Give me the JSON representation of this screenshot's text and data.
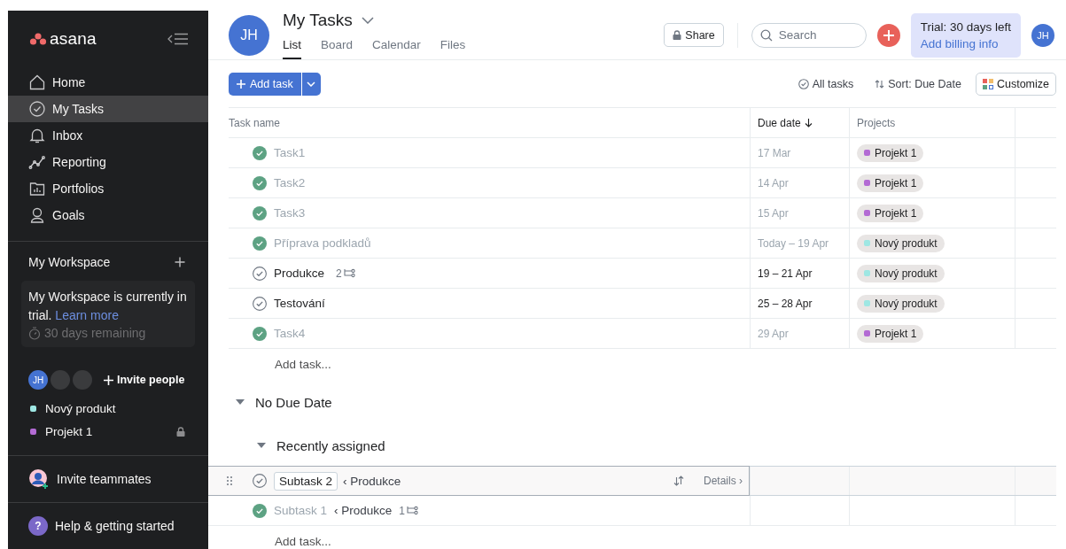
{
  "sidebar": {
    "brand": "asana",
    "nav": [
      {
        "label": "Home",
        "selected": false
      },
      {
        "label": "My Tasks",
        "selected": true
      },
      {
        "label": "Inbox",
        "selected": false
      },
      {
        "label": "Reporting",
        "selected": false
      },
      {
        "label": "Portfolios",
        "selected": false
      },
      {
        "label": "Goals",
        "selected": false
      }
    ],
    "workspace": {
      "title": "My Workspace",
      "trial_text": "My Workspace is currently in trial.",
      "learn_more": "Learn more",
      "remaining": "30 days remaining"
    },
    "members": [
      "JH"
    ],
    "invite_people": "Invite people",
    "projects": [
      {
        "name": "Nový produkt",
        "color": "#9ee7e3",
        "locked": false
      },
      {
        "name": "Projekt 1",
        "color": "#b36bd4",
        "locked": true
      }
    ],
    "invite_teammates": "Invite teammates",
    "help": {
      "icon": "?",
      "label": "Help & getting started"
    }
  },
  "header": {
    "avatar": "JH",
    "title": "My Tasks",
    "tabs": [
      {
        "label": "List",
        "selected": true
      },
      {
        "label": "Board",
        "selected": false
      },
      {
        "label": "Calendar",
        "selected": false
      },
      {
        "label": "Files",
        "selected": false
      }
    ],
    "share": "Share",
    "search": {
      "placeholder": "Search"
    },
    "trial": {
      "title": "Trial: 30 days left",
      "link": "Add billing info"
    },
    "user_avatar": "JH"
  },
  "toolbar": {
    "add_task": "Add task",
    "all_tasks": "All tasks",
    "sort": "Sort: Due Date",
    "customize": "Customize"
  },
  "table": {
    "columns": [
      "Task name",
      "Due date",
      "Projects"
    ],
    "rows": [
      {
        "name": "Task1",
        "completed": true,
        "subtasks": "",
        "due": "17 Mar",
        "project": {
          "name": "Projekt 1",
          "color": "#b36bd4"
        }
      },
      {
        "name": "Task2",
        "completed": true,
        "subtasks": "",
        "due": "14 Apr",
        "project": {
          "name": "Projekt 1",
          "color": "#b36bd4"
        }
      },
      {
        "name": "Task3",
        "completed": true,
        "subtasks": "",
        "due": "15 Apr",
        "project": {
          "name": "Projekt 1",
          "color": "#b36bd4"
        }
      },
      {
        "name": "Příprava podkladů",
        "completed": true,
        "subtasks": "",
        "due": "Today – 19 Apr",
        "project": {
          "name": "Nový produkt",
          "color": "#9ee7e3"
        }
      },
      {
        "name": "Produkce",
        "completed": false,
        "subtasks": "2",
        "due": "19 – 21 Apr",
        "project": {
          "name": "Nový produkt",
          "color": "#9ee7e3"
        }
      },
      {
        "name": "Testování",
        "completed": false,
        "subtasks": "",
        "due": "25 – 28 Apr",
        "project": {
          "name": "Nový produkt",
          "color": "#9ee7e3"
        }
      },
      {
        "name": "Task4",
        "completed": true,
        "subtasks": "",
        "due": "29 Apr",
        "project": {
          "name": "Projekt 1",
          "color": "#b36bd4"
        }
      }
    ],
    "add_task": "Add task..."
  },
  "section": {
    "title": "No Due Date",
    "expanded": true,
    "subsection": {
      "title": "Recently assigned",
      "expanded": true,
      "rows": [
        {
          "name": "Subtask 2",
          "completed": false,
          "selected": true,
          "parent": "‹ Produkce",
          "subtasks": "",
          "details": "Details ›"
        },
        {
          "name": "Subtask 1",
          "completed": true,
          "selected": false,
          "parent": "‹ Produkce",
          "subtasks": "1",
          "details": ""
        }
      ],
      "add_task": "Add task..."
    }
  }
}
